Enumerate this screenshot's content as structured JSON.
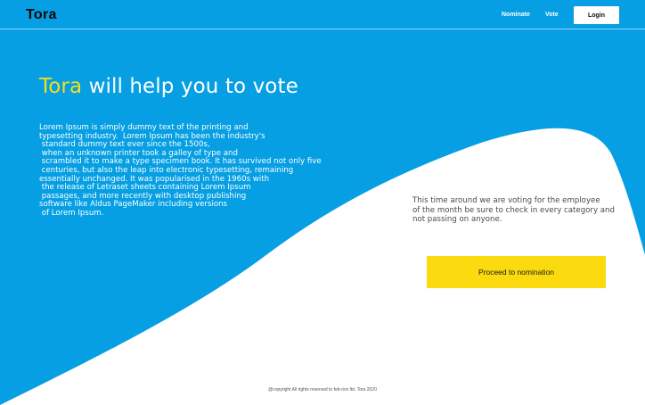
{
  "brand": {
    "logo": "Tora"
  },
  "nav": {
    "nominate": "Nominate",
    "vote": "Vote",
    "login": "Login"
  },
  "hero": {
    "title_brand": "Tora",
    "title_rest": " will help you to vote",
    "body": "Lorem Ipsum is simply dummy text of the printing and\ntypesetting industry.  Lorem Ipsum has been the industry's\n standard dummy text ever since the 1500s,\n when an unknown printer took a galley of type and\n scrambled it to make a type specimen book. It has survived not only five\n centuries, but also the leap into electronic typesetting, remaining\nessentially unchanged. It was popularised in the 1960s with\n the release of Letraset sheets containing Lorem Ipsum\n passages, and more recently with desktop publishing\nsoftware like Aldus PageMaker including versions\n of Lorem Ipsum."
  },
  "info": {
    "text": "This time around we are voting for the employee\nof the month be sure to check in every category and\nnot passing on anyone."
  },
  "cta": {
    "label": "Proceed to nomination"
  },
  "footer": {
    "text": "@copyright  All rights reserved to feb-rice ltd.  Tora 2020"
  },
  "colors": {
    "primary_blue": "#069fe3",
    "accent_yellow": "#fbda10",
    "brand_yellow": "#f3df1c",
    "background": "#ffffff"
  }
}
